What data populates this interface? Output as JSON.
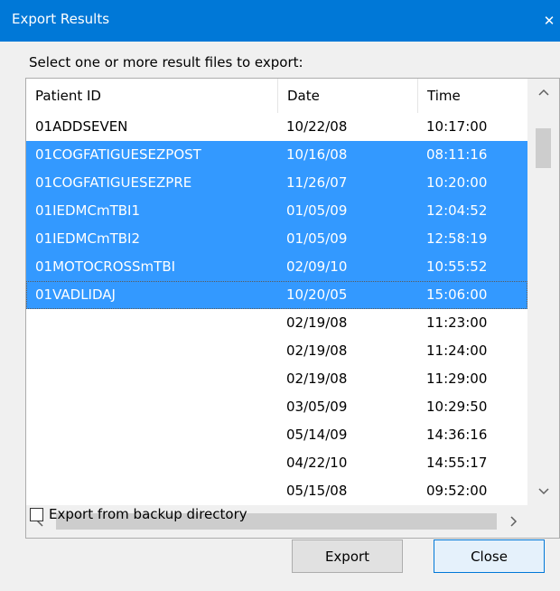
{
  "window": {
    "title": "Export Results",
    "close_glyph": "✕"
  },
  "prompt": "Select one or more result files to export:",
  "columns": [
    "Patient ID",
    "Date",
    "Time"
  ],
  "rows": [
    {
      "id": "01ADDSEVEN",
      "date": "10/22/08",
      "time": "10:17:00",
      "selected": false
    },
    {
      "id": "01COGFATIGUESEZPOST",
      "date": "10/16/08",
      "time": "08:11:16",
      "selected": true
    },
    {
      "id": "01COGFATIGUESEZPRE",
      "date": "11/26/07",
      "time": "10:20:00",
      "selected": true
    },
    {
      "id": "01IEDMCmTBI1",
      "date": "01/05/09",
      "time": "12:04:52",
      "selected": true
    },
    {
      "id": "01IEDMCmTBI2",
      "date": "01/05/09",
      "time": "12:58:19",
      "selected": true
    },
    {
      "id": "01MOTOCROSSmTBI",
      "date": "02/09/10",
      "time": "10:55:52",
      "selected": true
    },
    {
      "id": "01VADLIDAJ",
      "date": "10/20/05",
      "time": "15:06:00",
      "selected": true,
      "focused": true
    },
    {
      "id": "",
      "date": "02/19/08",
      "time": "11:23:00",
      "selected": false
    },
    {
      "id": "",
      "date": "02/19/08",
      "time": "11:24:00",
      "selected": false
    },
    {
      "id": "",
      "date": "02/19/08",
      "time": "11:29:00",
      "selected": false
    },
    {
      "id": "",
      "date": "03/05/09",
      "time": "10:29:50",
      "selected": false
    },
    {
      "id": "",
      "date": "05/14/09",
      "time": "14:36:16",
      "selected": false
    },
    {
      "id": "",
      "date": "04/22/10",
      "time": "14:55:17",
      "selected": false
    },
    {
      "id": "",
      "date": "05/15/08",
      "time": "09:52:00",
      "selected": false
    }
  ],
  "scroll_icons": {
    "up": "chevron-up-icon",
    "down": "chevron-down-icon",
    "left": "chevron-left-icon",
    "right": "chevron-right-icon"
  },
  "checkbox": {
    "label": "Export from backup directory",
    "checked": false
  },
  "buttons": {
    "export": "Export",
    "close": "Close"
  },
  "colors": {
    "titlebar": "#0078d7",
    "selection": "#3399ff",
    "dialog_bg": "#f0f0f0"
  }
}
